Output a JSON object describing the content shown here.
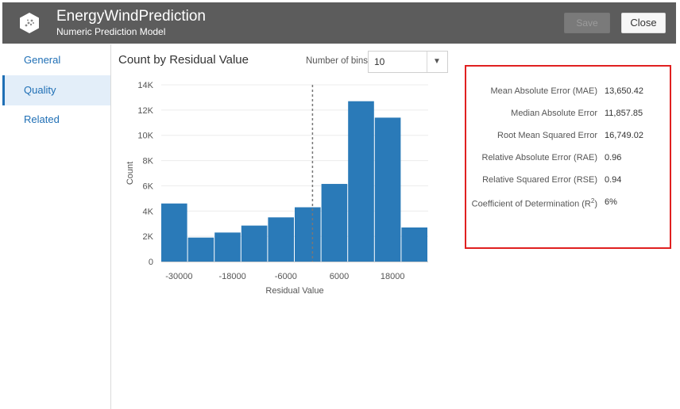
{
  "header": {
    "title": "EnergyWindPrediction",
    "subtitle": "Numeric Prediction Model",
    "save_label": "Save",
    "close_label": "Close",
    "logo_icon": "model-hexagon-icon"
  },
  "sidebar": {
    "items": [
      {
        "label": "General",
        "active": false
      },
      {
        "label": "Quality",
        "active": true
      },
      {
        "label": "Related",
        "active": false
      }
    ]
  },
  "chart_panel": {
    "title": "Count by Residual Value",
    "bins_label": "Number of bins",
    "bins_value": "10"
  },
  "chart_data": {
    "type": "bar",
    "title": "Count by Residual Value",
    "xlabel": "Residual Value",
    "ylabel": "Count",
    "bins": [
      {
        "from": -34000,
        "to": -28000,
        "count": 4600
      },
      {
        "from": -28000,
        "to": -22000,
        "count": 1900
      },
      {
        "from": -22000,
        "to": -16000,
        "count": 2300
      },
      {
        "from": -16000,
        "to": -10000,
        "count": 2850
      },
      {
        "from": -10000,
        "to": -4000,
        "count": 3500
      },
      {
        "from": -4000,
        "to": 2000,
        "count": 4300
      },
      {
        "from": 2000,
        "to": 8000,
        "count": 6150
      },
      {
        "from": 8000,
        "to": 14000,
        "count": 12700
      },
      {
        "from": 14000,
        "to": 20000,
        "count": 11400
      },
      {
        "from": 20000,
        "to": 26000,
        "count": 2700
      }
    ],
    "xlim": [
      -34000,
      26000
    ],
    "ylim": [
      0,
      14000
    ],
    "x_ticks": [
      -30000,
      -18000,
      -6000,
      6000,
      18000
    ],
    "y_ticks": [
      0,
      2000,
      4000,
      6000,
      8000,
      10000,
      12000,
      14000
    ],
    "y_tick_labels": [
      "0",
      "2K",
      "4K",
      "6K",
      "8K",
      "10K",
      "12K",
      "14K"
    ],
    "x_tick_labels": [
      "-30000",
      "-18000",
      "-6000",
      "6000",
      "18000"
    ],
    "reference_line_x": 0,
    "bar_color": "#2a7ab8",
    "grid": true
  },
  "metrics": [
    {
      "label": "Mean Absolute Error (MAE)",
      "value": "13,650.42"
    },
    {
      "label": "Median Absolute Error",
      "value": "11,857.85"
    },
    {
      "label": "Root Mean Squared Error",
      "value": "16,749.02"
    },
    {
      "label": "Relative Absolute Error (RAE)",
      "value": "0.96"
    },
    {
      "label": "Relative Squared Error (RSE)",
      "value": "0.94"
    },
    {
      "label": "Coefficient of Determination (R",
      "label_sup": "2",
      "label_suffix": ")",
      "value": "6%"
    }
  ],
  "colors": {
    "header_bg": "#5c5c5c",
    "accent": "#1f6fb5",
    "highlight_border": "#e02020"
  }
}
